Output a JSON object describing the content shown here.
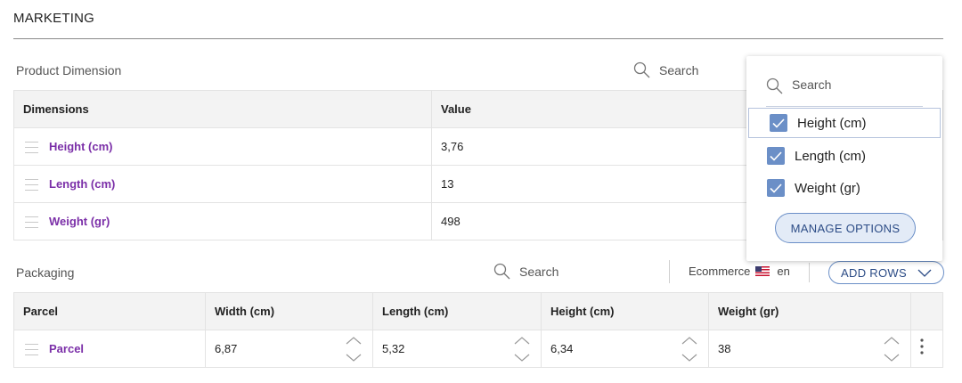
{
  "section": {
    "title": "MARKETING"
  },
  "product_dimension": {
    "label": "Product Dimension",
    "search_placeholder": "Search",
    "columns": [
      "Dimensions",
      "Value"
    ],
    "rows": [
      {
        "name": "Height (cm)",
        "value": "3,76"
      },
      {
        "name": "Length (cm)",
        "value": "13"
      },
      {
        "name": "Weight (gr)",
        "value": "498"
      }
    ]
  },
  "column_picker": {
    "search_placeholder": "Search",
    "options": [
      {
        "label": "Height (cm)",
        "checked": true
      },
      {
        "label": "Length (cm)",
        "checked": true
      },
      {
        "label": "Weight (gr)",
        "checked": true
      }
    ],
    "manage_label": "MANAGE OPTIONS"
  },
  "packaging": {
    "label": "Packaging",
    "search_placeholder": "Search",
    "channel": "Ecommerce",
    "locale": "en",
    "add_rows_label": "ADD ROWS",
    "columns": [
      "Parcel",
      "Width (cm)",
      "Length (cm)",
      "Height (cm)",
      "Weight (gr)"
    ],
    "rows": [
      {
        "name": "Parcel",
        "width": "6,87",
        "length": "5,32",
        "height": "6,34",
        "weight": "38"
      }
    ]
  },
  "colors": {
    "accent": "#6b8fc7",
    "link": "#7b2fa8"
  },
  "icons": [
    "search-icon",
    "drag-handle-icon",
    "checkbox-checked-icon",
    "chevron-down-icon",
    "stepper-icon",
    "more-vertical-icon",
    "us-flag-icon"
  ]
}
